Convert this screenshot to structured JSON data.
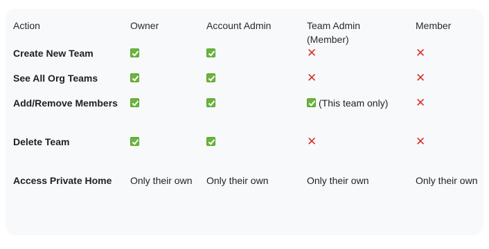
{
  "columns": [
    "Action",
    "Owner",
    "Account Admin",
    "Team Admin (Member)",
    "Member"
  ],
  "header_lines": {
    "team_admin_line1": "Team Admin",
    "team_admin_line2": "(Member)"
  },
  "rows": [
    {
      "action": "Create New Team",
      "owner": "allowed",
      "account_admin": "allowed",
      "team_admin": "denied",
      "member": "denied"
    },
    {
      "action": "See All Org Teams",
      "owner": "allowed",
      "account_admin": "allowed",
      "team_admin": "denied",
      "member": "denied"
    },
    {
      "action": "Add/Remove Members",
      "owner": "allowed",
      "account_admin": "allowed",
      "team_admin": "allowed",
      "team_admin_note": "(This team only)",
      "member": "denied"
    },
    {
      "action": "Delete Team",
      "owner": "allowed",
      "account_admin": "allowed",
      "team_admin": "denied",
      "member": "denied"
    },
    {
      "action": "Access Private Home",
      "owner": "Only their own",
      "account_admin": "Only their own",
      "team_admin": "Only their own",
      "member": "Only their own"
    }
  ],
  "icons": {
    "allowed": "check-mark-icon",
    "denied": "cross-mark-icon"
  },
  "colors": {
    "check_green": "#6ab53b",
    "cross_red": "#d93025",
    "card_background": "#f8f9fb"
  }
}
